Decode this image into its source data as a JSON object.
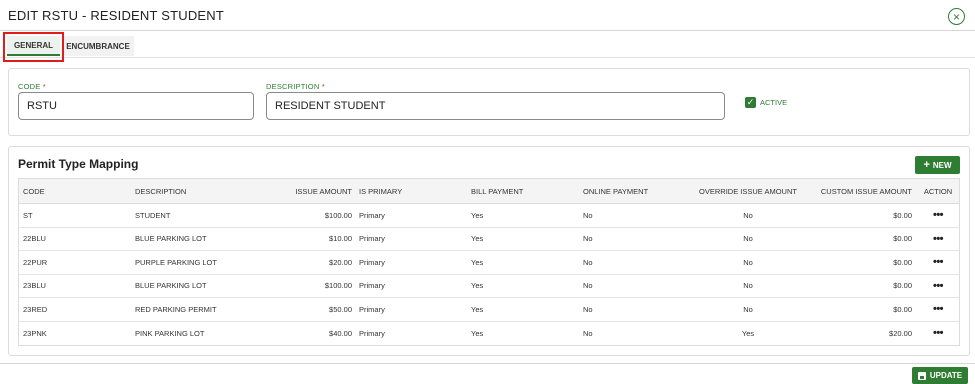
{
  "header": {
    "title": "EDIT RSTU - RESIDENT STUDENT",
    "close_glyph": "×"
  },
  "tabs": [
    {
      "label": "GENERAL",
      "active": true
    },
    {
      "label": "ENCUMBRANCE",
      "active": false
    }
  ],
  "form": {
    "code": {
      "label": "CODE",
      "required": "*",
      "value": "RSTU"
    },
    "description": {
      "label": "DESCRIPTION",
      "required": "*",
      "value": "RESIDENT STUDENT"
    },
    "active": {
      "label": "ACTIVE",
      "checked": true,
      "check_glyph": "✓"
    }
  },
  "mapping": {
    "title": "Permit Type Mapping",
    "new_label": "NEW",
    "new_glyph": "+",
    "columns": [
      "CODE",
      "DESCRIPTION",
      "ISSUE AMOUNT",
      "IS PRIMARY",
      "BILL PAYMENT",
      "ONLINE PAYMENT",
      "OVERRIDE ISSUE AMOUNT",
      "CUSTOM ISSUE AMOUNT",
      "ACTION"
    ],
    "action_glyph": "•••",
    "rows": [
      {
        "code": "ST",
        "description": "STUDENT",
        "issue_amount": "$100.00",
        "is_primary": "Primary",
        "bill_payment": "Yes",
        "online_payment": "No",
        "override": "No",
        "custom": "$0.00"
      },
      {
        "code": "22BLU",
        "description": "BLUE PARKING LOT",
        "issue_amount": "$10.00",
        "is_primary": "Primary",
        "bill_payment": "Yes",
        "online_payment": "No",
        "override": "No",
        "custom": "$0.00"
      },
      {
        "code": "22PUR",
        "description": "PURPLE PARKING LOT",
        "issue_amount": "$20.00",
        "is_primary": "Primary",
        "bill_payment": "Yes",
        "online_payment": "No",
        "override": "No",
        "custom": "$0.00"
      },
      {
        "code": "23BLU",
        "description": "BLUE PARKING LOT",
        "issue_amount": "$100.00",
        "is_primary": "Primary",
        "bill_payment": "Yes",
        "online_payment": "No",
        "override": "No",
        "custom": "$0.00"
      },
      {
        "code": "23RED",
        "description": "RED PARKING PERMIT",
        "issue_amount": "$50.00",
        "is_primary": "Primary",
        "bill_payment": "Yes",
        "online_payment": "No",
        "override": "No",
        "custom": "$0.00"
      },
      {
        "code": "23PNK",
        "description": "PINK PARKING LOT",
        "issue_amount": "$40.00",
        "is_primary": "Primary",
        "bill_payment": "Yes",
        "online_payment": "No",
        "override": "Yes",
        "custom": "$20.00"
      }
    ]
  },
  "footer": {
    "update_label": "UPDATE",
    "icon": "save-icon"
  },
  "colors": {
    "accent": "#2e7d32",
    "highlight": "#e21b1b",
    "required": "#d32f2f"
  }
}
